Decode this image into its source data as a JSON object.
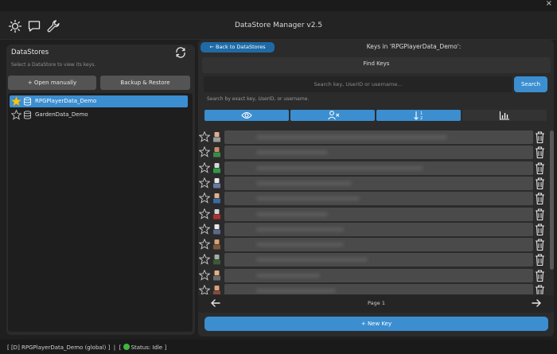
{
  "window": {
    "title": "DataStore Manager v2.5",
    "close_glyph": "×"
  },
  "toolbar": {
    "icons": [
      "sun-icon",
      "chat-icon",
      "wrench-icon"
    ]
  },
  "left": {
    "title": "DataStores",
    "subtitle": "Select a DataStore to view its keys.",
    "open_manually": "+ Open manually",
    "backup_restore": "Backup & Restore",
    "datastores": [
      {
        "name": "RPGPlayerData_Demo",
        "selected": true,
        "favorite": true
      },
      {
        "name": "GardenData_Demo",
        "selected": false,
        "favorite": false
      }
    ]
  },
  "right": {
    "back_label": "← Back to DataStores",
    "keys_title": "Keys in 'RPGPlayerData_Demo':",
    "find_title": "Find Keys",
    "search_placeholder": "Search key, UserID or username...",
    "search_label": "Search",
    "hint": "Search by exact key, UserID, or username.",
    "page_label": "Page 1",
    "new_key": "+ New Key",
    "accent": "#3b8ed0"
  },
  "status": {
    "text_left": "[ [D] RPGPlayerData_Demo (global) ]",
    "separator": "|",
    "text_right": "Status: Idle ]",
    "bracket_open": "["
  }
}
